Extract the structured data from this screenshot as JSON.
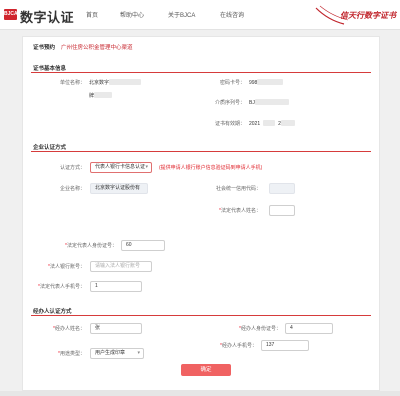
{
  "header": {
    "logo_mark": "BJCA",
    "logo_text": "数字认证",
    "nav": [
      "首页",
      "帮助中心",
      "关于BJCA",
      "在线咨询"
    ],
    "slogan": "信天行数字证书"
  },
  "breadcrumb": {
    "key": "证书预约",
    "value": "广州住房公积金管理中心渠道"
  },
  "cert_info": {
    "title": "证书基本信息",
    "unit_label": "单位名称：",
    "unit_value": "北京数字",
    "unit_value_2": "牌",
    "card_label": "密码卡号：",
    "card_value": "998",
    "medium_label": "介质序列号：",
    "medium_value": "BJ",
    "validity_label": "证书有效期：",
    "validity_value": "2021",
    "validity_value_2": "2"
  },
  "enterprise": {
    "title": "企业认证方式",
    "method_label": "认证方式：",
    "method_value": "代表人银行卡信息认证",
    "method_hint": "(提供申请人银行账户信息验证码到申请人手机)",
    "company_label": "企业名称：",
    "company_value": "北京数字认证股份有",
    "credit_label": "社会统一信用代码：",
    "legal_name_label": "法定代表人姓名：",
    "legal_id_label": "法定代表人身份证号：",
    "legal_id_value": "60",
    "bank_label": "法人银行账号：",
    "bank_placeholder": "请输入法人银行账号",
    "phone_label": "法定代表人手机号：",
    "phone_value": "1"
  },
  "operator": {
    "title": "经办人认证方式",
    "name_label": "经办人姓名：",
    "name_value": "张",
    "id_label": "经办人身份证号：",
    "id_value": "4",
    "phone_label": "经办人手机号：",
    "phone_value": "137",
    "purpose_label": "用途类型：",
    "purpose_value": "用户生成印章"
  },
  "actions": {
    "confirm": "确定"
  }
}
